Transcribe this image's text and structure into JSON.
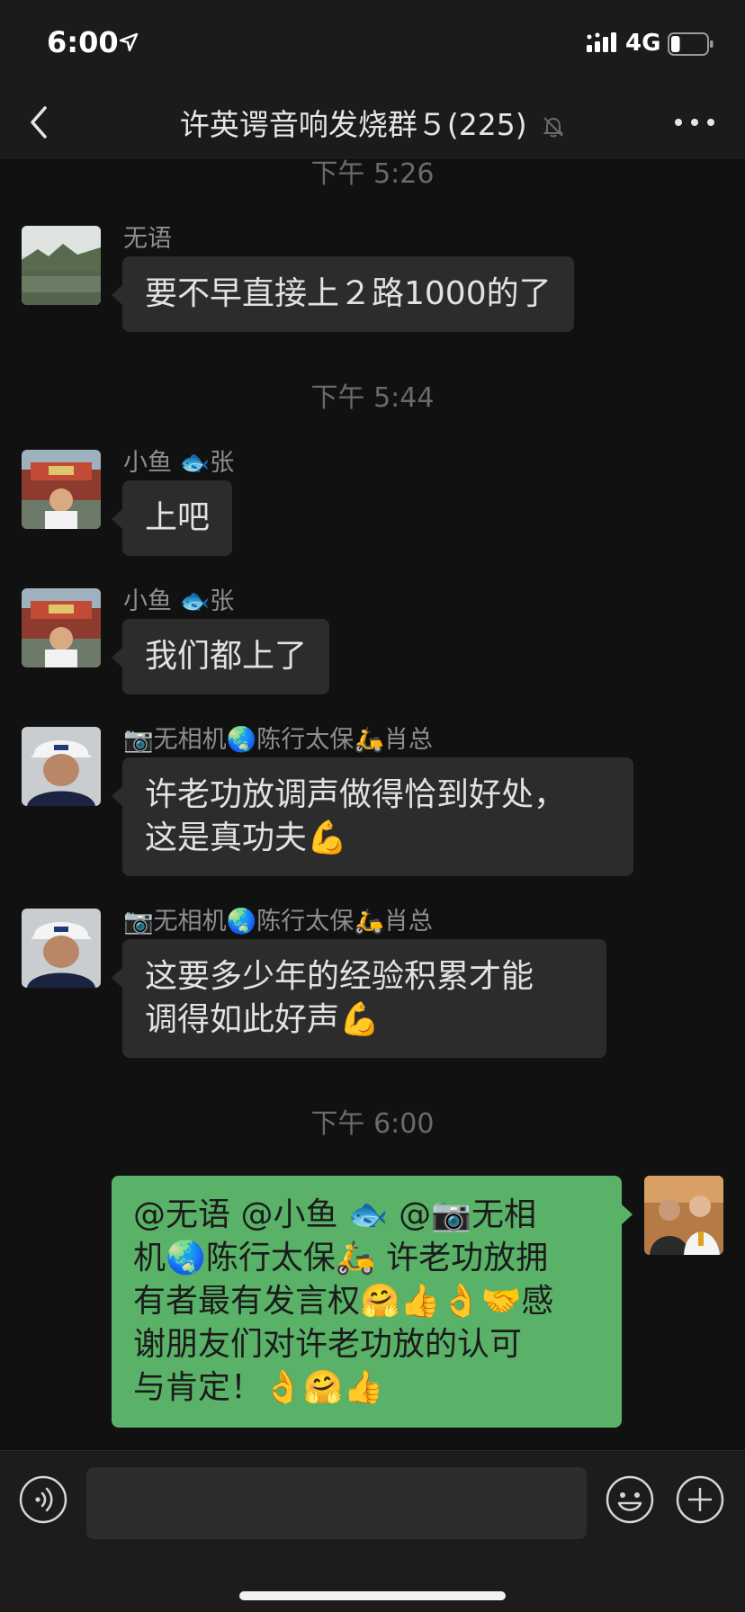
{
  "status_bar": {
    "time": "6:00",
    "network": "4G",
    "battery_level": 0.25
  },
  "header": {
    "title": "许英谔音响发烧群５(225)"
  },
  "timestamps": [
    "下午 5:26",
    "下午 5:44",
    "下午 6:00"
  ],
  "messages": [
    {
      "sender": "无语",
      "text": "要不早直接上２路1000的了"
    },
    {
      "sender": "小鱼 🐟张",
      "text": "上吧"
    },
    {
      "sender": "小鱼 🐟张",
      "text": "我们都上了"
    },
    {
      "sender": "📷无相机🌏陈行太保🛵肖总",
      "line1": "许老功放调声做得恰到好处，",
      "line2": "这是真功夫💪"
    },
    {
      "sender": "📷无相机🌏陈行太保🛵肖总",
      "line1": "这要多少年的经验积累才能",
      "line2": "调得如此好声💪"
    }
  ],
  "outgoing": {
    "lines": [
      "@无语 @小鱼 🐟 @📷无相",
      "机🌏陈行太保🛵 许老功放拥",
      "有者最有发言权🤗👍👌🤝感",
      "谢朋友们对许老功放的认可",
      "与肯定！👌🤗👍"
    ]
  },
  "input": {
    "value": "",
    "placeholder": ""
  },
  "icons": {
    "back": "chevron-left-icon",
    "mute": "bell-off-icon",
    "more": "more-dots-icon",
    "voice": "voice-icon",
    "emoji": "emoji-icon",
    "plus": "plus-icon"
  },
  "colors": {
    "outgoing_bubble": "#5ab268",
    "incoming_bubble": "#2c2c2c",
    "background": "#111111"
  }
}
